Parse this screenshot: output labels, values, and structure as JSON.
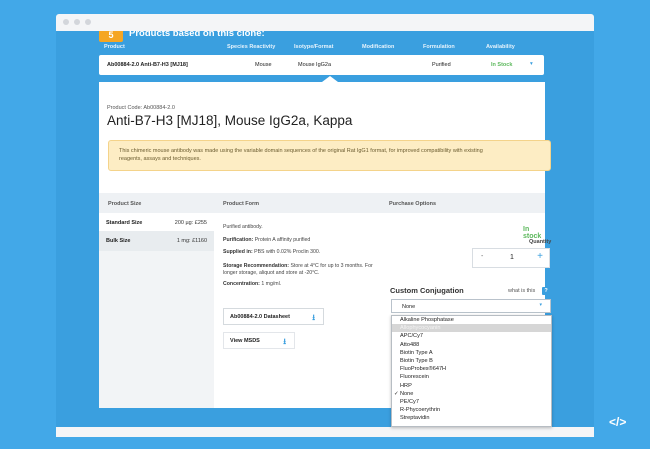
{
  "clone_header": {
    "count": "5",
    "title": "Products based on this clone:",
    "columns": [
      "Product",
      "Species Reactivity",
      "Isotype/Format",
      "Modification",
      "Formulation",
      "Availability"
    ],
    "row": {
      "product": "Ab00884-2.0 Anti-B7-H3 [MJ18]",
      "species": "Mouse",
      "isotype": "Mouse IgG2a",
      "modification": "",
      "formulation": "Purified",
      "availability": "In Stock",
      "caret": "▾"
    }
  },
  "product": {
    "code": "Product Code: Ab00884-2.0",
    "title": "Anti-B7-H3 [MJ18], Mouse IgG2a, Kappa",
    "notice_line1": "This chimeric mouse antibody was made using the variable domain sequences of the original Rat IgG1 format, for improved compatibility with existing",
    "notice_line2": "reagents, assays and techniques."
  },
  "table": {
    "headers": [
      "Product Size",
      "Product Form",
      "Purchase Options"
    ],
    "sizes": [
      {
        "name": "Standard Size",
        "price": "200 µg: £255"
      },
      {
        "name": "Bulk Size",
        "price": "1 mg: £1160"
      }
    ]
  },
  "form": {
    "description": "Purified antibody.",
    "purification_label": "Purification:",
    "purification_value": " Protein A affinity purified",
    "supplied_label": "Supplied in:",
    "supplied_value": " PBS with 0.02% Proclin 300.",
    "storage_label": "Storage Recommendation:",
    "storage_value": " Store at 4°C for up to 3 months. For longer storage, aliquot and store at -20°C.",
    "concentration_label": "Concentration:",
    "concentration_value": " 1 mg/ml.",
    "datasheet_label": "Ab00884-2.0 Datasheet",
    "msds_label": "View MSDS",
    "download_icon": "⭳"
  },
  "purchase": {
    "stock": "In stock",
    "quantity_label": "Quantity",
    "quantity_value": "1",
    "minus": "-",
    "plus": "+",
    "conjugation_title": "Custom Conjugation",
    "what_label": "what is this",
    "what_icon": "?",
    "selected": "None",
    "select_caret": "▾",
    "options": [
      "Alkaline Phosphatase",
      "Allophycocyanin",
      "APC/Cy7",
      "Atto488",
      "Biotin Type A",
      "Biotin Type B",
      "FluoProbes®647H",
      "Fluorescein",
      "HRP",
      "None",
      "PE/Cy7",
      "R-Phycoerythrin",
      "Streptavidin"
    ],
    "checkmark": "✓"
  },
  "corner_logo": "</>"
}
